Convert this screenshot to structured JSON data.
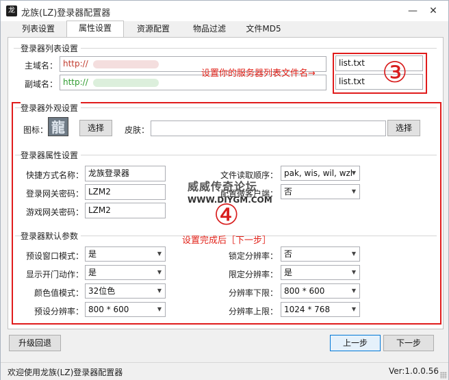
{
  "window": {
    "title": "龙族(LZ)登录器配置器",
    "app_icon_glyph": "龙",
    "minimize_glyph": "—",
    "close_glyph": "✕"
  },
  "tabs": [
    {
      "label": "列表设置",
      "active": false
    },
    {
      "label": "属性设置",
      "active": true
    },
    {
      "label": "资源配置",
      "active": false
    },
    {
      "label": "物品过滤",
      "active": false
    },
    {
      "label": "文件MD5",
      "active": false
    }
  ],
  "server_list": {
    "group_title": "登录器列表设置",
    "main_label": "主域名：",
    "main_prefix": "http://",
    "alt_label": "副域名：",
    "alt_prefix": "http://",
    "main_file": "list.txt",
    "alt_file": "list.txt",
    "annotation": "设置你的服务器列表文件名→",
    "step_marker": "③",
    "main_prefix_color": "#c0392b",
    "alt_prefix_color": "#2e9b2e"
  },
  "appearance": {
    "group_title": "登录器外观设置",
    "icon_label": "图标：",
    "icon_glyph": "龍",
    "icon_select_button": "选择",
    "skin_label": "皮肤：",
    "skin_value": "",
    "skin_select_button": "选择"
  },
  "properties": {
    "group_title": "登录器属性设置",
    "shortcut_label": "快捷方式名称：",
    "shortcut_value": "龙族登录器",
    "login_pwd_label": "登录网关密码：",
    "login_pwd_value": "LZM2",
    "game_pwd_label": "游戏网关密码：",
    "game_pwd_value": "LZM2",
    "file_order_label": "文件读取顺序：",
    "file_order_value": "pak, wis, wil, wzl",
    "micro_client_label": "配置微客户端：",
    "micro_client_value": "否"
  },
  "watermark": {
    "title": "威威传奇论坛",
    "url": "WWW.DIYGM.COM"
  },
  "defaults": {
    "group_title": "登录器默认参数",
    "annotation": "设置完成后［下一步］",
    "step_marker": "④",
    "left_rows": [
      {
        "label": "预设窗口模式：",
        "value": "是"
      },
      {
        "label": "显示开门动作：",
        "value": "是"
      },
      {
        "label": "颜色值模式：",
        "value": "32位色"
      },
      {
        "label": "预设分辨率：",
        "value": "800 * 600"
      }
    ],
    "right_rows": [
      {
        "label": "锁定分辨率：",
        "value": "否"
      },
      {
        "label": "限定分辨率：",
        "value": "是"
      },
      {
        "label": "分辨率下限：",
        "value": "800 * 600"
      },
      {
        "label": "分辨率上限：",
        "value": "1024 * 768"
      }
    ]
  },
  "footer": {
    "downgrade_button": "升级回退",
    "prev_button": "上一步",
    "next_button": "下一步"
  },
  "status": {
    "welcome": "欢迎使用龙族(LZ)登录器配置器",
    "version": "Ver:1.0.0.56"
  },
  "colors": {
    "annotation_red": "#e2231a",
    "accent_blue": "#0078d7"
  }
}
